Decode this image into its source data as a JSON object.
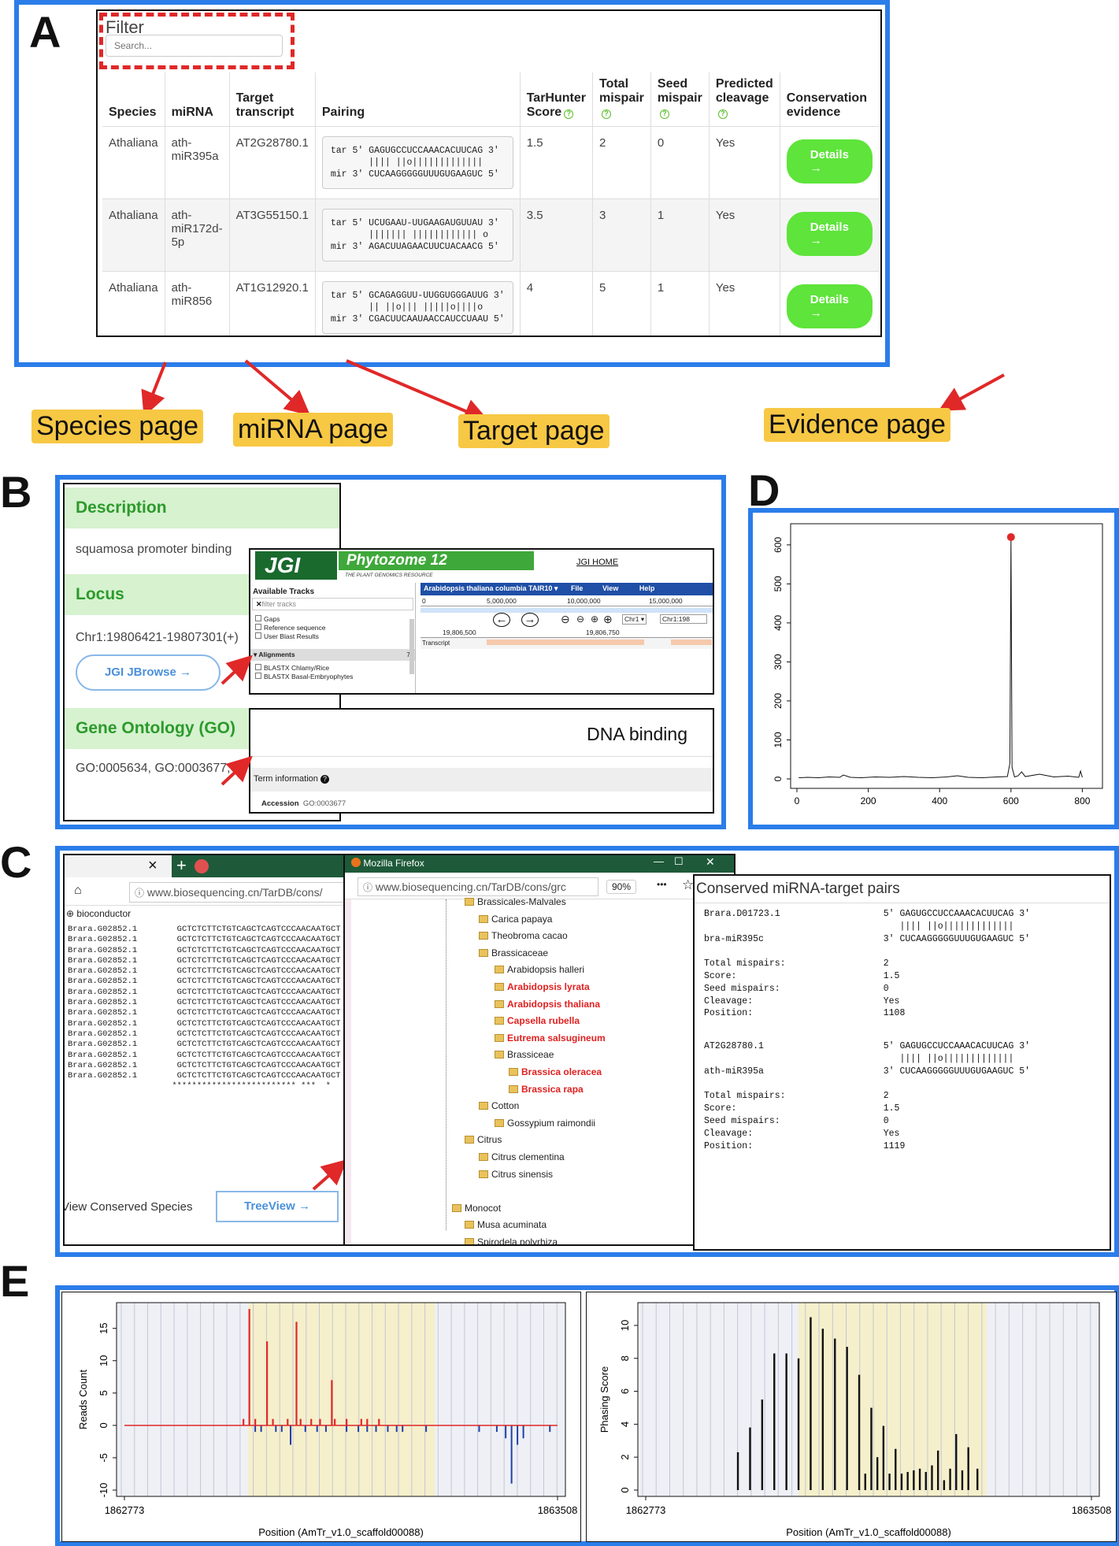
{
  "panels": {
    "a": "A",
    "b": "B",
    "c": "C",
    "d": "D",
    "e": "E"
  },
  "filter": {
    "title": "Filter",
    "placeholder": "Search..."
  },
  "table": {
    "headers": {
      "species": "Species",
      "mirna": "miRNA",
      "target": "Target transcript",
      "pairing": "Pairing",
      "score": "TarHunter Score",
      "total": "Total mispair",
      "seed": "Seed mispair",
      "cleavage": "Predicted cleavage",
      "conservation": "Conservation evidence"
    },
    "rows": [
      {
        "species": "Athaliana",
        "mirna": "ath-miR395a",
        "target": "AT2G28780.1",
        "pairing": "tar 5' GAGUGCCUCCAAACACUUCAG 3'\n       |||| ||o|||||||||||||\nmir 3' CUCAAGGGGGUUUGUGAAGUC 5'",
        "score": "1.5",
        "total": "2",
        "seed": "0",
        "cleavage": "Yes",
        "button": "Details →"
      },
      {
        "species": "Athaliana",
        "mirna": "ath-miR172d-5p",
        "target": "AT3G55150.1",
        "pairing": "tar 5' UCUGAAU-UUGAAGAUGUUAU 3'\n       ||||||| |||||||||||| o\nmir 3' AGACUUAGAACUUCUACAACG 5'",
        "score": "3.5",
        "total": "3",
        "seed": "1",
        "cleavage": "Yes",
        "button": "Details →"
      },
      {
        "species": "Athaliana",
        "mirna": "ath-miR856",
        "target": "AT1G12920.1",
        "pairing": "tar 5' GCAGAGGUU-UUGGUGGGAUUG 3'\n       || ||o||| |||||o||||o\nmir 3' CGACUUCAAUAACCAUCCUAAU 5'",
        "score": "4",
        "total": "5",
        "seed": "1",
        "cleavage": "Yes",
        "button": "Details →"
      }
    ]
  },
  "callouts": {
    "species": "Species page",
    "mirna": "miRNA page",
    "target": "Target page",
    "evidence": "Evidence page"
  },
  "desc": {
    "heading": "Description",
    "text": "squamosa promoter binding",
    "locus_heading": "Locus",
    "locus": "Chr1:19806421-19807301(+)",
    "jbrowse": "JGI JBrowse →",
    "go_heading": "Gene Ontology (GO)",
    "go": "GO:0005634, GO:0003677,"
  },
  "jgi": {
    "logo": "JGI",
    "phytozome": "Phytozome 12",
    "tagline": "THE PLANT GENOMICS RESOURCE",
    "home": "JGI HOME",
    "available": "Available Tracks",
    "filter": "filter tracks",
    "tracks": [
      "Gaps",
      "Reference sequence",
      "User Blast Results"
    ],
    "alignments": "Alignments",
    "aln_count": "7",
    "aln_tracks": [
      "BLASTX Chlamy/Rice",
      "BLASTX Basal-Embryophytes"
    ],
    "genome": "Arabidopsis thaliana columbia TAIR10",
    "menu": [
      "File",
      "View",
      "Help"
    ],
    "scale": [
      "0",
      "5,000,000",
      "10,000,000",
      "15,000,000"
    ],
    "chr": "Chr1",
    "loc": "Chr1:198",
    "pos1": "19,806,500",
    "pos2": "19,806,750",
    "transcript": "Transcript"
  },
  "go_box": {
    "term": "DNA binding",
    "info": "Term information",
    "acc_label": "Accession",
    "acc": "GO:0003677"
  },
  "chart_d": {
    "type": "line",
    "xticks": [
      "0",
      "200",
      "400",
      "600",
      "800"
    ],
    "yticks": [
      "0",
      "100",
      "200",
      "300",
      "400",
      "500",
      "600"
    ],
    "xlim": [
      0,
      830
    ],
    "ylim": [
      0,
      630
    ],
    "peak": {
      "x": 600,
      "y": 620
    },
    "baseline_points": [
      [
        5,
        3
      ],
      [
        30,
        4
      ],
      [
        60,
        3
      ],
      [
        90,
        5
      ],
      [
        120,
        4
      ],
      [
        130,
        10
      ],
      [
        150,
        4
      ],
      [
        180,
        3
      ],
      [
        220,
        5
      ],
      [
        260,
        4
      ],
      [
        300,
        6
      ],
      [
        340,
        4
      ],
      [
        380,
        3
      ],
      [
        420,
        5
      ],
      [
        450,
        8
      ],
      [
        480,
        4
      ],
      [
        520,
        3
      ],
      [
        560,
        5
      ],
      [
        590,
        6
      ],
      [
        597,
        40
      ],
      [
        600,
        620
      ],
      [
        603,
        30
      ],
      [
        610,
        5
      ],
      [
        620,
        8
      ],
      [
        630,
        18
      ],
      [
        640,
        6
      ],
      [
        680,
        12
      ],
      [
        720,
        5
      ],
      [
        760,
        7
      ],
      [
        790,
        4
      ],
      [
        795,
        20
      ],
      [
        800,
        4
      ]
    ]
  },
  "browser": {
    "url1": "www.biosequencing.cn/TarDB/cons/",
    "bioconductor": "bioconductor",
    "tab_close": "×",
    "tab_new": "+",
    "firefox": "Mozilla Firefox",
    "url2": "www.biosequencing.cn/TarDB/cons/grc",
    "zoom": "90%",
    "more": "•••",
    "star": "☆",
    "view": "View Conserved Species",
    "treeview": "TreeView →"
  },
  "alignment": {
    "id": "Brara.G02852.1",
    "seq": "GCTCTCTTCTGTCAGCTCAGTCCCAACAATGCT",
    "count": 15,
    "stars": "************************* ***  *"
  },
  "tree": [
    {
      "t": "Brassicales-Malvales",
      "l": 1,
      "r": false
    },
    {
      "t": "Carica papaya",
      "l": 2,
      "r": false
    },
    {
      "t": "Theobroma cacao",
      "l": 2,
      "r": false
    },
    {
      "t": "Brassicaceae",
      "l": 2,
      "r": false
    },
    {
      "t": "Arabidopsis halleri",
      "l": 3,
      "r": false
    },
    {
      "t": "Arabidopsis lyrata",
      "l": 3,
      "r": true
    },
    {
      "t": "Arabidopsis thaliana",
      "l": 3,
      "r": true
    },
    {
      "t": "Capsella rubella",
      "l": 3,
      "r": true
    },
    {
      "t": "Eutrema salsugineum",
      "l": 3,
      "r": true
    },
    {
      "t": "Brassiceae",
      "l": 3,
      "r": false
    },
    {
      "t": "Brassica oleracea",
      "l": 4,
      "r": true
    },
    {
      "t": "Brassica rapa",
      "l": 4,
      "r": true
    },
    {
      "t": "Cotton",
      "l": 2,
      "r": false
    },
    {
      "t": "Gossypium raimondii",
      "l": 3,
      "r": false
    },
    {
      "t": "Citrus",
      "l": 1,
      "r": false
    },
    {
      "t": "Citrus clementina",
      "l": 2,
      "r": false
    },
    {
      "t": "Citrus sinensis",
      "l": 2,
      "r": false
    },
    {
      "t": "",
      "l": 0,
      "r": false
    },
    {
      "t": "Monocot",
      "l": 0,
      "r": false
    },
    {
      "t": "Musa acuminata",
      "l": 1,
      "r": false
    },
    {
      "t": "Spirodela polyrhiza",
      "l": 1,
      "r": false
    }
  ],
  "conserved": {
    "title": "Conserved miRNA-target pairs",
    "p1": "Brara.D01723.1                   5' GAGUGCCUCCAAACACUUCAG 3'\n                                    |||| ||o|||||||||||||\nbra-miR395c                      3' CUCAAGGGGGUUUGUGAAGUC 5'\n\nTotal mispairs:                  2\nScore:                           1.5\nSeed mispairs:                   0\nCleavage:                        Yes\nPosition:                        1108",
    "p2": "AT2G28780.1                      5' GAGUGCCUCCAAACACUUCAG 3'\n                                    |||| ||o|||||||||||||\nath-miR395a                      3' CUCAAGGGGGUUUGUGAAGUC 5'\n\nTotal mispairs:                  2\nScore:                           1.5\nSeed mispairs:                   0\nCleavage:                        Yes\nPosition:                        1119"
  },
  "chart_data": [
    {
      "type": "bar",
      "ylabel": "Reads Count",
      "xlabel": "Position (AmTr_v1.0_scaffold00088)",
      "xticks": [
        "1862773",
        "1863508"
      ],
      "yticks": [
        "-10",
        "-5",
        "0",
        "5",
        "10",
        "15"
      ],
      "xlim": [
        1862773,
        1863508
      ],
      "ylim": [
        -10,
        18
      ],
      "highlight": [
        1862983,
        1863300
      ],
      "positive": [
        [
          1862975,
          1
        ],
        [
          1862985,
          18
        ],
        [
          1862995,
          1
        ],
        [
          1863015,
          13
        ],
        [
          1863025,
          1
        ],
        [
          1863050,
          1
        ],
        [
          1863065,
          16
        ],
        [
          1863072,
          1
        ],
        [
          1863090,
          1
        ],
        [
          1863105,
          1
        ],
        [
          1863125,
          7
        ],
        [
          1863130,
          1
        ],
        [
          1863150,
          1
        ],
        [
          1863175,
          1
        ],
        [
          1863185,
          1
        ],
        [
          1863205,
          1
        ]
      ],
      "negative": [
        [
          1862995,
          -1
        ],
        [
          1863005,
          -1
        ],
        [
          1863030,
          -1
        ],
        [
          1863040,
          -1
        ],
        [
          1863055,
          -3
        ],
        [
          1863080,
          -1
        ],
        [
          1863100,
          -1
        ],
        [
          1863115,
          -1
        ],
        [
          1863150,
          -1
        ],
        [
          1863170,
          -1
        ],
        [
          1863185,
          -1
        ],
        [
          1863200,
          -1
        ],
        [
          1863220,
          -1
        ],
        [
          1863235,
          -1
        ],
        [
          1863245,
          -1
        ],
        [
          1863285,
          -1
        ],
        [
          1863375,
          -1
        ],
        [
          1863405,
          -1
        ],
        [
          1863420,
          -2
        ],
        [
          1863430,
          -9
        ],
        [
          1863440,
          -3
        ],
        [
          1863450,
          -2
        ],
        [
          1863495,
          -1
        ]
      ]
    },
    {
      "type": "bar",
      "ylabel": "Phasing Score",
      "xlabel": "Position (AmTr_v1.0_scaffold00088)",
      "xticks": [
        "1862773",
        "1863508"
      ],
      "yticks": [
        "0",
        "2",
        "4",
        "6",
        "8",
        "10"
      ],
      "xlim": [
        1862773,
        1863508
      ],
      "ylim": [
        0,
        11
      ],
      "highlight": [
        1863025,
        1863335
      ],
      "values": [
        [
          1862925,
          2.3
        ],
        [
          1862945,
          3.8
        ],
        [
          1862965,
          5.5
        ],
        [
          1862985,
          8.3
        ],
        [
          1863005,
          8.3
        ],
        [
          1863025,
          8
        ],
        [
          1863045,
          10.5
        ],
        [
          1863065,
          9.8
        ],
        [
          1863085,
          9.2
        ],
        [
          1863105,
          8.7
        ],
        [
          1863125,
          7
        ],
        [
          1863135,
          1
        ],
        [
          1863145,
          5
        ],
        [
          1863155,
          2
        ],
        [
          1863165,
          3.9
        ],
        [
          1863175,
          1
        ],
        [
          1863185,
          2.5
        ],
        [
          1863195,
          1
        ],
        [
          1863205,
          1.1
        ],
        [
          1863215,
          1.2
        ],
        [
          1863225,
          1.3
        ],
        [
          1863235,
          1.1
        ],
        [
          1863245,
          1.5
        ],
        [
          1863255,
          2.4
        ],
        [
          1863265,
          0.6
        ],
        [
          1863275,
          1.3
        ],
        [
          1863285,
          3.4
        ],
        [
          1863295,
          1.2
        ],
        [
          1863305,
          2.6
        ],
        [
          1863320,
          1.3
        ]
      ]
    }
  ]
}
